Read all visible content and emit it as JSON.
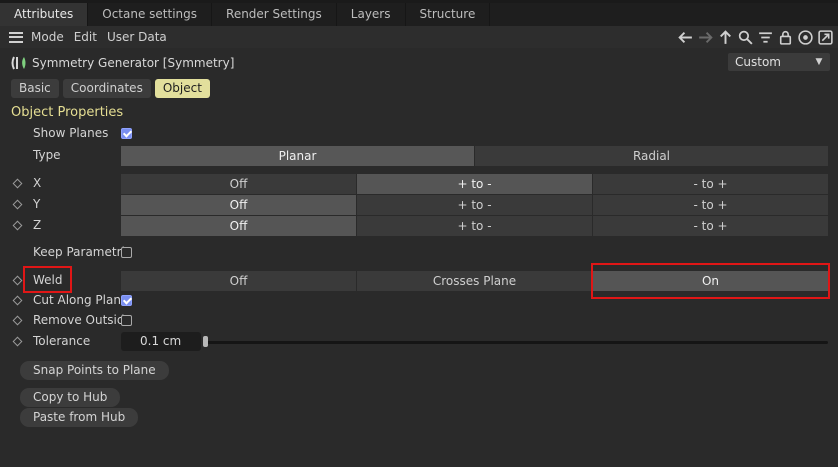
{
  "tabs": [
    {
      "label": "Attributes",
      "active": true
    },
    {
      "label": "Octane settings",
      "active": false
    },
    {
      "label": "Render Settings",
      "active": false
    },
    {
      "label": "Layers",
      "active": false
    },
    {
      "label": "Structure",
      "active": false
    }
  ],
  "menu": {
    "mode": "Mode",
    "edit": "Edit",
    "user_data": "User Data"
  },
  "toolbar_icons": [
    "back-arrow-icon",
    "forward-arrow-icon",
    "up-arrow-icon",
    "search-icon",
    "filter-icon",
    "lock-icon",
    "target-icon",
    "new-window-icon"
  ],
  "object": {
    "title": "Symmetry Generator [Symmetry]",
    "layout_select": "Custom"
  },
  "subtabs": [
    {
      "label": "Basic",
      "active": false
    },
    {
      "label": "Coordinates",
      "active": false
    },
    {
      "label": "Object",
      "active": true
    }
  ],
  "section_title": "Object Properties",
  "properties": {
    "show_planes": {
      "label": "Show Planes",
      "checked": true
    },
    "type": {
      "label": "Type",
      "options": [
        "Planar",
        "Radial"
      ],
      "selected": "Planar"
    },
    "x": {
      "label": "X",
      "options": [
        "Off",
        "+ to -",
        "- to +"
      ],
      "selected": "+ to -"
    },
    "y": {
      "label": "Y",
      "options": [
        "Off",
        "+ to -",
        "- to +"
      ],
      "selected": "Off"
    },
    "z": {
      "label": "Z",
      "options": [
        "Off",
        "+ to -",
        "- to +"
      ],
      "selected": "Off"
    },
    "keep_parametric": {
      "label": "Keep Parametric",
      "checked": false
    },
    "weld": {
      "label": "Weld",
      "options": [
        "Off",
        "Crosses Plane",
        "On"
      ],
      "selected": "On"
    },
    "cut_along_plane": {
      "label": "Cut Along Plane",
      "checked": true
    },
    "remove_outside": {
      "label": "Remove Outside",
      "checked": false
    },
    "tolerance": {
      "label": "Tolerance",
      "value": "0.1 cm",
      "slider_fraction": 0.0
    }
  },
  "buttons": {
    "snap_points": "Snap Points to Plane",
    "copy_to_hub": "Copy to Hub",
    "paste_from_hub": "Paste from Hub"
  },
  "colors": {
    "accent_yellow": "#e6df93",
    "checkbox_blue": "#7a8ff0",
    "highlight_red": "#e01616"
  }
}
